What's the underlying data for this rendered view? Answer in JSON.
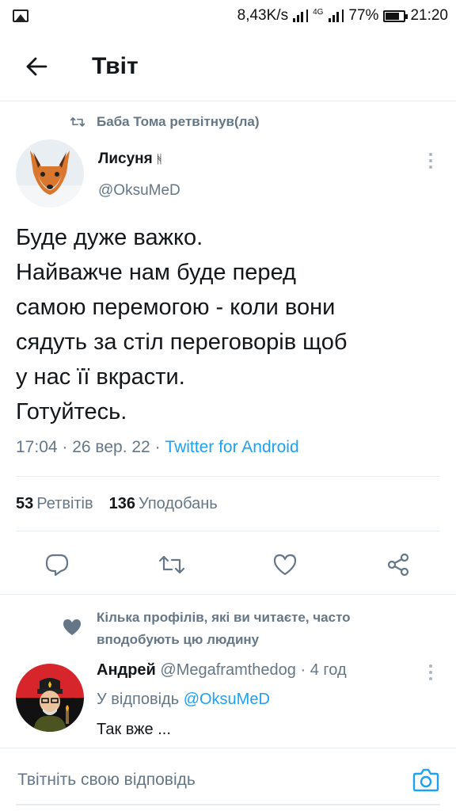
{
  "status_bar": {
    "network_speed": "8,43K/s",
    "network_type": "4G",
    "battery": "77%",
    "battery_level": 0.77,
    "time": "21:20"
  },
  "header": {
    "title": "Твіт",
    "back_icon": "arrow-left-icon"
  },
  "retweet_context": {
    "text": "Баба Тома ретвітнув(ла)",
    "icon": "retweet-icon"
  },
  "tweet": {
    "author_name": "Лисуня",
    "author_flag": "ᚻ",
    "author_handle": "@OksuMeD",
    "text_lines": [
      "Буде дуже важко.",
      "Найважче нам буде перед",
      "самою перемогою - коли вони",
      "сядуть за стіл переговорів щоб",
      "у нас її вкрасти.",
      "Готуйтесь."
    ],
    "time": "17:04",
    "date": "26 вер. 22",
    "source": "Twitter for Android",
    "meta_sep": " · "
  },
  "stats": {
    "retweets_count": "53",
    "retweets_label": "Ретвітів",
    "likes_count": "136",
    "likes_label": "Уподобань"
  },
  "actions": [
    {
      "icon": "reply-icon"
    },
    {
      "icon": "retweet-icon"
    },
    {
      "icon": "heart-icon"
    },
    {
      "icon": "share-icon"
    }
  ],
  "suggestion": {
    "text": "Кілька профілів, які ви читаєте, часто вподобують цю людину",
    "icon": "heart-icon"
  },
  "reply": {
    "author_name": "Андрей",
    "author_handle": "@Megaframthedog",
    "time_ago": "4 год",
    "reply_to_label": "У відповідь",
    "reply_to_handle": "@OksuMeD",
    "text": "Так вже ..."
  },
  "compose": {
    "placeholder": "Твітніть свою відповідь",
    "camera_icon": "camera-icon"
  },
  "colors": {
    "accent": "#1da1f2",
    "secondary_text": "#657786",
    "divider": "#e6ecf0"
  }
}
